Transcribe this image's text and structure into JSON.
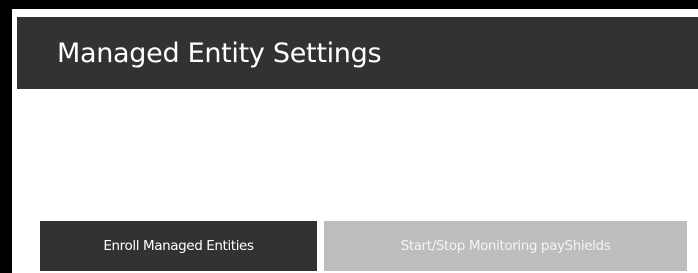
{
  "panel": {
    "title": "Managed Entity Settings"
  },
  "tabs": [
    {
      "label": "Enroll Managed Entities",
      "active": true
    },
    {
      "label": "Start/Stop Monitoring payShields",
      "active": false
    }
  ],
  "colors": {
    "header_bg": "#323232",
    "active_tab_bg": "#323232",
    "inactive_tab_bg": "#bdbdbd",
    "frame": "#000000"
  }
}
